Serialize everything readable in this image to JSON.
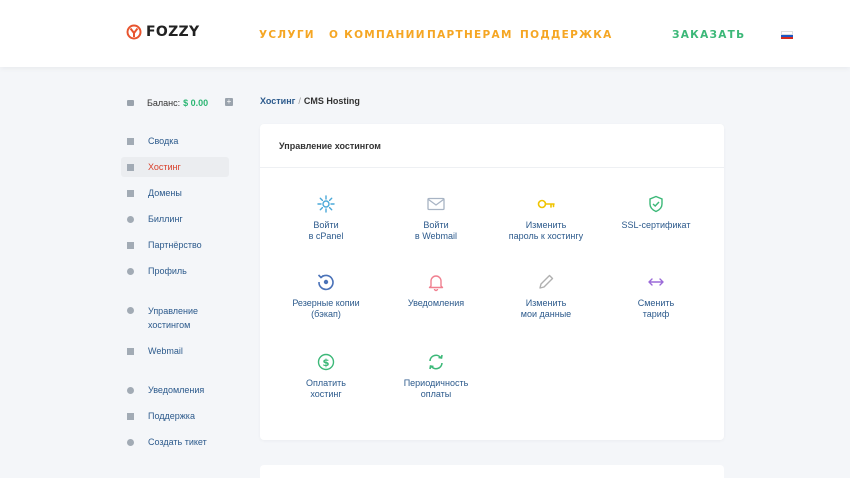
{
  "header": {
    "logo_text": "FOZZY",
    "nav": [
      "УСЛУГИ",
      "О КОМПАНИИ",
      "ПАРТНЕРАМ",
      "ПОДДЕРЖКА"
    ],
    "order_label": "ЗАКАЗАТЬ",
    "accent_color": "#f5a623",
    "order_color": "#3cb878"
  },
  "sidebar": {
    "balance_label": "Баланс:",
    "balance_value": "$ 0.00",
    "items": [
      {
        "label": "Сводка"
      },
      {
        "label": "Хостинг",
        "active": true
      },
      {
        "label": "Домены"
      },
      {
        "label": "Биллинг"
      },
      {
        "label": "Партнёрство"
      },
      {
        "label": "Профиль"
      },
      {
        "label": "Управление хостингом"
      },
      {
        "label": "Webmail"
      },
      {
        "label": "Уведомления"
      },
      {
        "label": "Поддержка"
      },
      {
        "label": "Создать тикет"
      }
    ],
    "active_color": "#d9402b"
  },
  "breadcrumb": {
    "parent": "Хостинг",
    "current": "CMS Hosting"
  },
  "card": {
    "title": "Управление хостингом",
    "tiles": [
      {
        "label": "Войти\nв cPanel",
        "icon": "gear-icon",
        "color": "#4aa8d8"
      },
      {
        "label": "Войти\nв Webmail",
        "icon": "mail-icon",
        "color": "#a8b4c4"
      },
      {
        "label": "Изменить\nпароль к хостингу",
        "icon": "key-icon",
        "color": "#f0c400"
      },
      {
        "label": "SSL-сертификат",
        "icon": "shield-check-icon",
        "color": "#3cb878"
      },
      {
        "label": "Резерные копии\n(бэкап)",
        "icon": "backup-icon",
        "color": "#4a72b8"
      },
      {
        "label": "Уведомления",
        "icon": "bell-icon",
        "color": "#f08090"
      },
      {
        "label": "Изменить\nмои данные",
        "icon": "pencil-icon",
        "color": "#b0b0b0"
      },
      {
        "label": "Сменить\nтариф",
        "icon": "swap-arrows-icon",
        "color": "#9b6ad8"
      },
      {
        "label": "Оплатить\nхостинг",
        "icon": "dollar-icon",
        "color": "#3cb878"
      },
      {
        "label": "Периодичность\nоплаты",
        "icon": "refresh-icon",
        "color": "#3cb878"
      }
    ]
  }
}
